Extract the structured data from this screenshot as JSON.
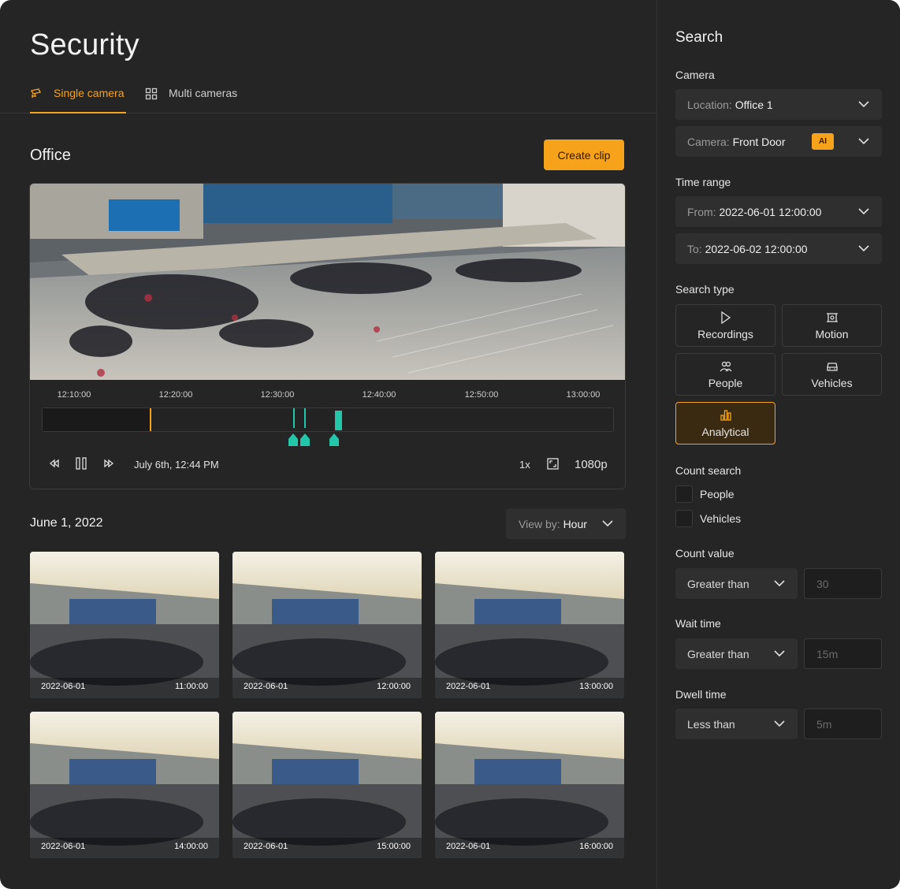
{
  "app": {
    "title": "Security",
    "accent": "#f7a21b",
    "event_color": "#23c6a8"
  },
  "tabs": [
    {
      "label": "Single camera",
      "icon": "cctv-camera-icon",
      "active": true
    },
    {
      "label": "Multi cameras",
      "icon": "grid-icon",
      "active": false
    }
  ],
  "main": {
    "section_title": "Office",
    "create_clip_label": "Create clip"
  },
  "player": {
    "time_ticks": [
      "12:10:00",
      "12:20:00",
      "12:30:00",
      "12:40:00",
      "12:50:00",
      "13:00:00"
    ],
    "timestamp": "July 6th, 12:44 PM",
    "speed": "1x",
    "quality": "1080p"
  },
  "grid": {
    "date_heading": "June 1, 2022",
    "view_by_label": "View by:",
    "view_by_value": "Hour",
    "thumbnails": [
      {
        "date": "2022-06-01",
        "time": "11:00:00"
      },
      {
        "date": "2022-06-01",
        "time": "12:00:00"
      },
      {
        "date": "2022-06-01",
        "time": "13:00:00"
      },
      {
        "date": "2022-06-01",
        "time": "14:00:00"
      },
      {
        "date": "2022-06-01",
        "time": "15:00:00"
      },
      {
        "date": "2022-06-01",
        "time": "16:00:00"
      }
    ]
  },
  "search": {
    "title": "Search",
    "camera_label": "Camera",
    "location_prefix": "Location:",
    "location_value": "Office 1",
    "camera_prefix": "Camera:",
    "camera_value": "Front Door",
    "ai_badge": "AI",
    "time_range_label": "Time range",
    "from_prefix": "From:",
    "from_value": "2022-06-01 12:00:00",
    "to_prefix": "To:",
    "to_value": "2022-06-02 12:00:00",
    "search_type_label": "Search type",
    "search_types": [
      {
        "label": "Recordings",
        "icon": "play-icon"
      },
      {
        "label": "Motion",
        "icon": "motion-icon"
      },
      {
        "label": "People",
        "icon": "people-icon"
      },
      {
        "label": "Vehicles",
        "icon": "car-icon"
      },
      {
        "label": "Analytical",
        "icon": "bar-chart-icon"
      }
    ],
    "count_search_label": "Count search",
    "count_people": "People",
    "count_vehicles": "Vehicles",
    "count_value_label": "Count value",
    "count_value_op": "Greater than",
    "count_value_placeholder": "30",
    "wait_time_label": "Wait time",
    "wait_time_op": "Greater than",
    "wait_time_placeholder": "15m",
    "dwell_time_label": "Dwell time",
    "dwell_time_op": "Less than",
    "dwell_time_placeholder": "5m"
  }
}
